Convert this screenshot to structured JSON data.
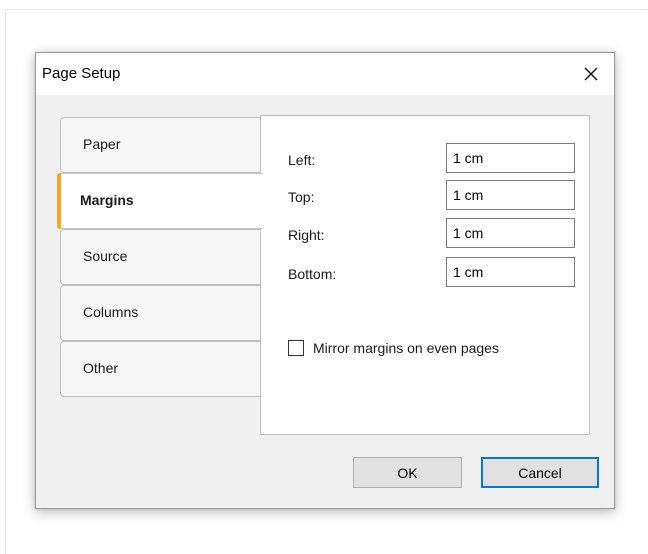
{
  "dialog": {
    "title": "Page Setup",
    "close_icon": "close-icon"
  },
  "tabs": [
    {
      "label": "Paper",
      "active": false
    },
    {
      "label": "Margins",
      "active": true
    },
    {
      "label": "Source",
      "active": false
    },
    {
      "label": "Columns",
      "active": false
    },
    {
      "label": "Other",
      "active": false
    }
  ],
  "margins": {
    "left_label": "Left:",
    "left_value": "1 cm",
    "top_label": "Top:",
    "top_value": "1 cm",
    "right_label": "Right:",
    "right_value": "1 cm",
    "bottom_label": "Bottom:",
    "bottom_value": "1 cm",
    "mirror_label": "Mirror margins on even pages",
    "mirror_checked": false
  },
  "buttons": {
    "ok": "OK",
    "cancel": "Cancel"
  },
  "colors": {
    "accent": "#f5a623",
    "default_button_border": "#0078d7",
    "dialog_bg": "#f0f0f0"
  }
}
